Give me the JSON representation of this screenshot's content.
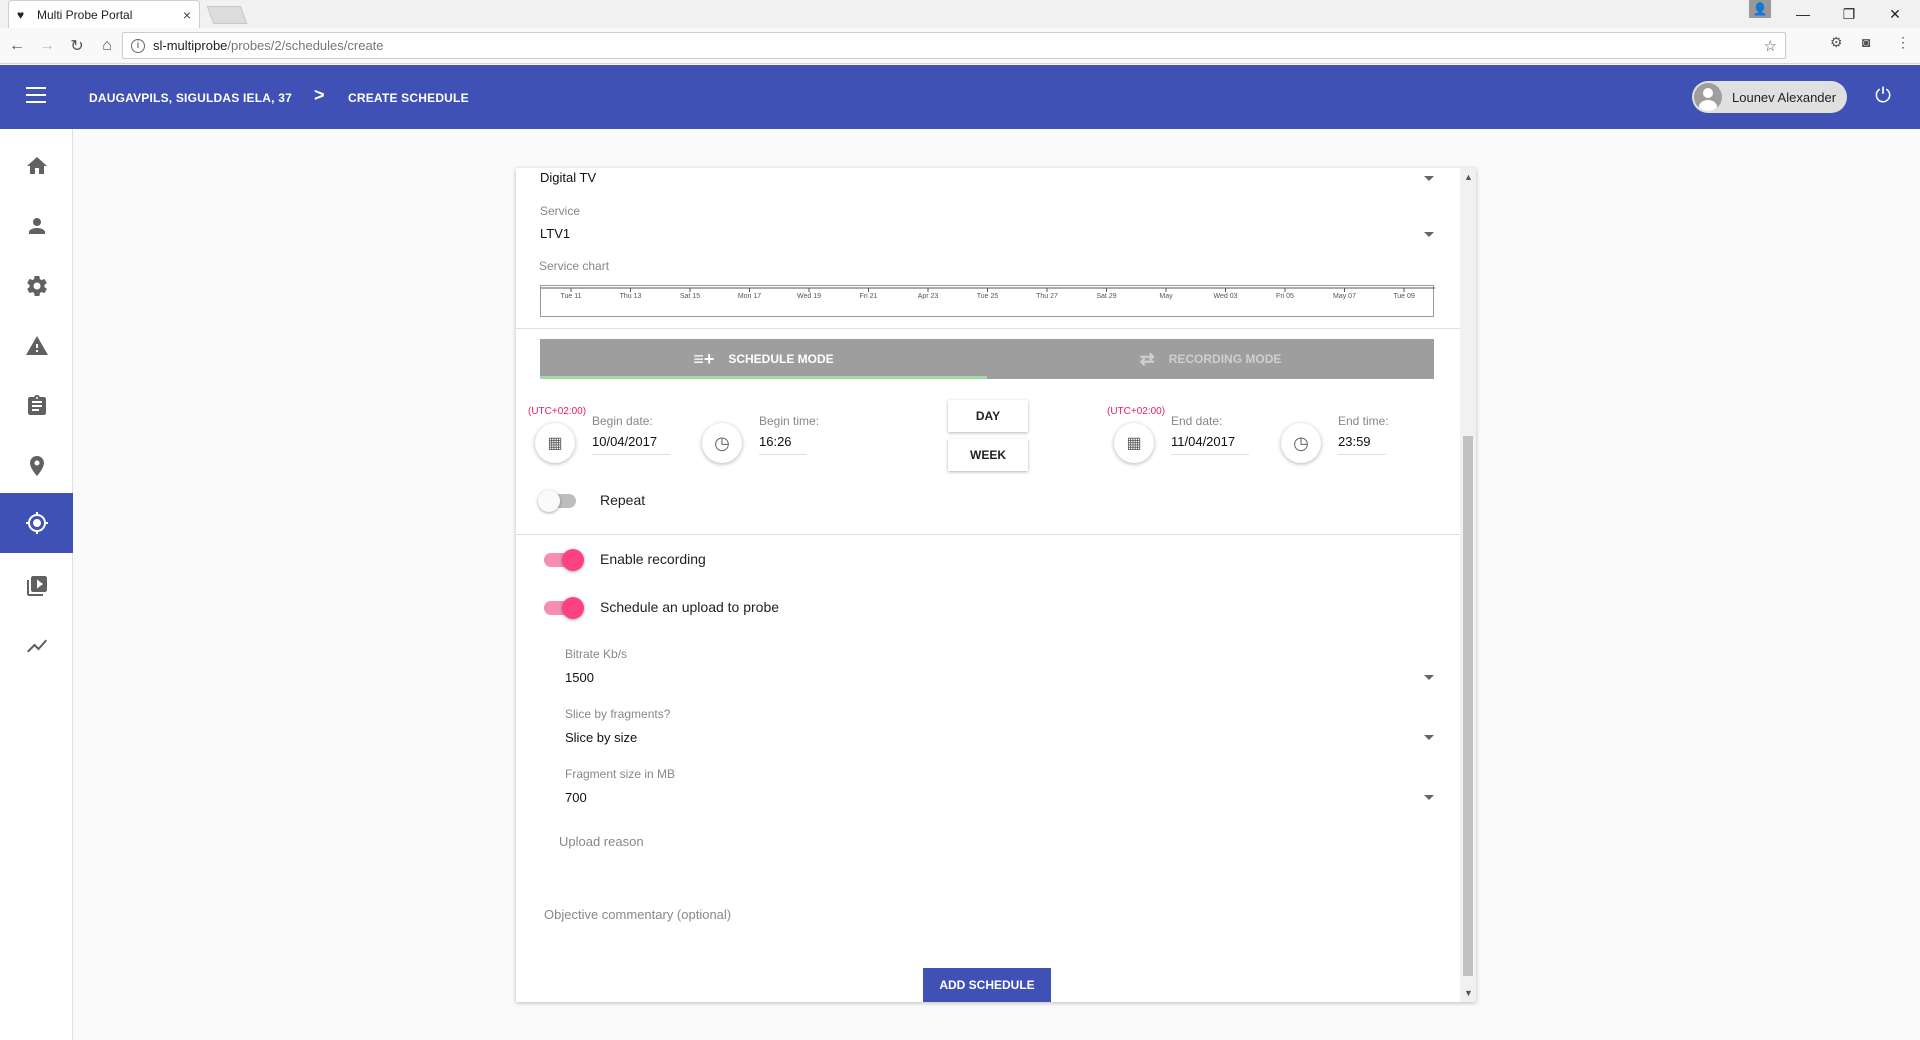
{
  "browser": {
    "tab_title": "Multi Probe Portal",
    "tab_close": "×",
    "url_host": "sl-multiprobe",
    "url_path": "/probes/2/schedules/create",
    "window_controls": [
      "—",
      "❐",
      "✕"
    ]
  },
  "header": {
    "location": "DAUGAVPILS, SIGULDAS IELA, 37",
    "separator": ">",
    "page": "CREATE SCHEDULE",
    "user_name": "Lounev Alexander"
  },
  "sidebar": {
    "items": [
      {
        "name": "home",
        "icon": "home-icon"
      },
      {
        "name": "users",
        "icon": "person-icon"
      },
      {
        "name": "settings",
        "icon": "gear-icon"
      },
      {
        "name": "alerts",
        "icon": "warning-icon"
      },
      {
        "name": "reports",
        "icon": "clipboard-icon"
      },
      {
        "name": "locations",
        "icon": "location-pin-icon"
      },
      {
        "name": "probes",
        "icon": "target-icon",
        "active": true
      },
      {
        "name": "media",
        "icon": "video-library-icon"
      },
      {
        "name": "statistics",
        "icon": "trending-icon"
      }
    ]
  },
  "form": {
    "type_value": "Digital TV",
    "service_label": "Service",
    "service_value": "LTV1",
    "service_chart_label": "Service chart",
    "chart_ticks": [
      "Tue 11",
      "Thu 13",
      "Sat 15",
      "Mon 17",
      "Wed 19",
      "Fri 21",
      "Apr 23",
      "Tue 25",
      "Thu 27",
      "Sat 29",
      "May",
      "Wed 03",
      "Fri 05",
      "May 07",
      "Tue 09"
    ],
    "tabs": {
      "schedule": "SCHEDULE MODE",
      "recording": "RECORDING MODE"
    },
    "begin": {
      "tz": "(UTC+02:00)",
      "date_label": "Begin date:",
      "date_value": "10/04/2017",
      "time_label": "Begin time:",
      "time_value": "16:26"
    },
    "end": {
      "tz": "(UTC+02:00)",
      "date_label": "End date:",
      "date_value": "11/04/2017",
      "time_label": "End time:",
      "time_value": "23:59"
    },
    "day_button": "DAY",
    "week_button": "WEEK",
    "repeat_label": "Repeat",
    "repeat_on": false,
    "enable_recording_label": "Enable recording",
    "enable_recording_on": true,
    "upload_label": "Schedule an upload to probe",
    "upload_on": true,
    "bitrate_label": "Bitrate Kb/s",
    "bitrate_value": "1500",
    "slice_label": "Slice by fragments?",
    "slice_value": "Slice by size",
    "fragment_label": "Fragment size in MB",
    "fragment_value": "700",
    "upload_reason_placeholder": "Upload reason",
    "commentary_placeholder": "Objective commentary (optional)",
    "submit_label": "ADD SCHEDULE"
  },
  "colors": {
    "primary": "#3f51b5",
    "accent": "#ff4081",
    "tz_text": "#e91e63",
    "tab_bar": "#9e9e9e",
    "tab_ink": "#a5d6a7"
  }
}
